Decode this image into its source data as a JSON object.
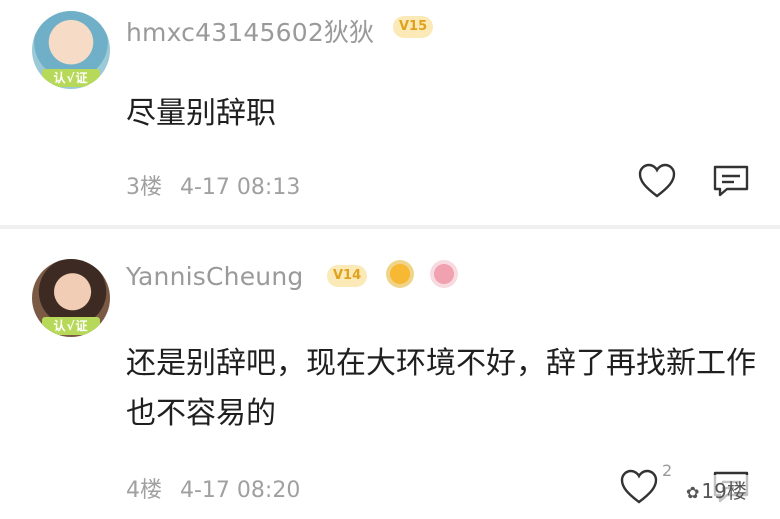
{
  "comments": [
    {
      "username": "hmxc43145602狄狄",
      "level": "V15",
      "verify_label": "认√证",
      "content": "尽量别辞职",
      "floor": "3楼",
      "time": "4-17 08:13",
      "like_count": ""
    },
    {
      "username": "YannisCheung",
      "level": "V14",
      "verify_label": "认√证",
      "content": "还是别辞吧，现在大环境不好，辞了再找新工作也不容易的",
      "floor": "4楼",
      "time": "4-17 08:20",
      "like_count": "2"
    }
  ],
  "watermark": {
    "text": "19楼"
  },
  "icons": {
    "like": "heart-outline-icon",
    "reply": "comment-bubble-icon",
    "medals": [
      "pen-medal-icon",
      "flower-medal-icon"
    ]
  },
  "colors": {
    "username": "#9a9a9a",
    "level_bg": "#fbeab7",
    "level_text": "#e0a21c",
    "verify_badge": "#b7d95a",
    "meta": "#a0a0a0"
  }
}
